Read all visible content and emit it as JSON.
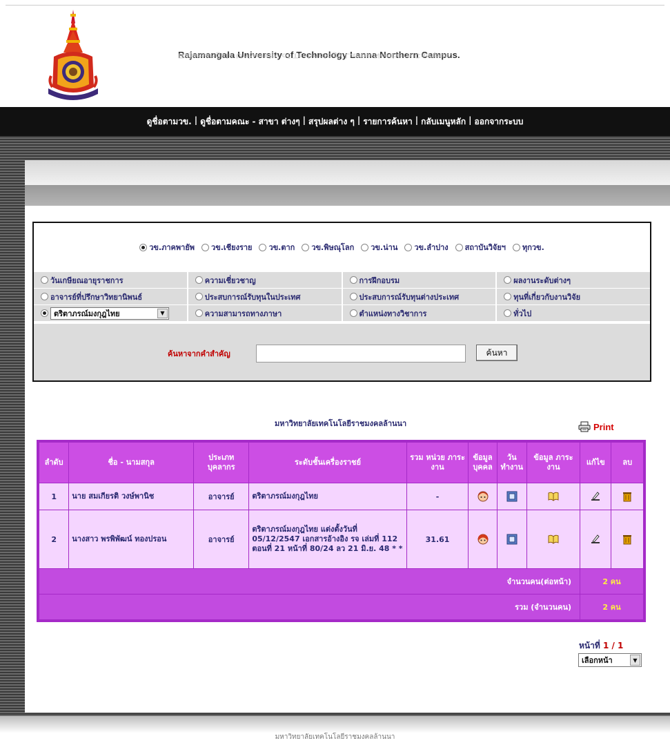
{
  "header": {
    "university_name": "Rajamangala University of Technology Lanna Northern Campus."
  },
  "nav": {
    "links": [
      "ดูชื่อตามวข.",
      "ดูชื่อตามคณะ - สาขา ต่างๆ",
      "สรุปผลต่าง ๆ",
      "รายการค้นหา",
      "กลับเมนูหลัก",
      "ออกจากระบบ"
    ],
    "separator": "|"
  },
  "search": {
    "campuses": [
      {
        "label": "วข.ภาคพายัพ",
        "selected": true
      },
      {
        "label": "วข.เชียงราย",
        "selected": false
      },
      {
        "label": "วข.ตาก",
        "selected": false
      },
      {
        "label": "วข.พิษณุโลก",
        "selected": false
      },
      {
        "label": "วข.น่าน",
        "selected": false
      },
      {
        "label": "วข.ลำปาง",
        "selected": false
      },
      {
        "label": "สถาบันวิจัยฯ",
        "selected": false
      },
      {
        "label": "ทุกวข.",
        "selected": false
      }
    ],
    "categories": {
      "row1": [
        "วันเกษียณอายุราชการ",
        "ความเชี่ยวชาญ",
        "การฝึกอบรม",
        "ผลงานระดับต่างๆ"
      ],
      "row2": [
        "อาจารย์ที่ปรึกษาวิทยานิพนธ์",
        "ประสบการณ์รับทุนในประเทศ",
        "ประสบการณ์รับทุนต่างประเทศ",
        "ทุนที่เกี่ยวกับงานวิจัย"
      ],
      "row3_select": "ตริตาภรณ์มงกุฎไทย",
      "row3": [
        "ความสามารถทางภาษา",
        "ตำแหน่งทางวิชาการ",
        "ทั่วไป"
      ]
    },
    "keyword_label": "ค้นหาจากคำสำคัญ",
    "keyword_value": "",
    "button_label": "ค้นหา"
  },
  "results": {
    "title": "มหาวิทยาลัยเทคโนโลยีราชมงคลล้านนา",
    "print_label": "Print",
    "columns": {
      "no": "ลำดับ",
      "name": "ชื่อ - นามสกุล",
      "type": "ประเภท บุคลากร",
      "decoration": "ระดับชั้นเครื่องราชย์",
      "workload": "รวม หน่วย ภาระงาน",
      "person": "ข้อมูล บุคคล",
      "days": "วัน ทำงาน",
      "load": "ข้อมูล ภาระงาน",
      "edit": "แก้ไข",
      "delete": "ลบ"
    },
    "rows": [
      {
        "no": "1",
        "name": "นาย สมเกียรติ วงษ์พานิช",
        "type": "อาจารย์",
        "decoration": "ตริตาภรณ์มงกุฎไทย",
        "workload": "-"
      },
      {
        "no": "2",
        "name": "นางสาว พรพิพัฒน์ ทองปรอน",
        "type": "อาจารย์",
        "decoration": "ตริตาภรณ์มงกุฎไทย แต่งตั้งวันที่ 05/12/2547 เอกสารอ้างอิง รจ เล่มที่ 112 ตอนที่ 21 หน้าที่ 80/24 ลว 21 มิ.ย. 48 * *",
        "workload": "31.61"
      }
    ],
    "summary": [
      {
        "label": "จำนวนคน(ต่อหน้า)",
        "value": "2 คน"
      },
      {
        "label": "รวม (จำนวนคน)",
        "value": "2 คน"
      }
    ]
  },
  "pager": {
    "label": "หน้าที่",
    "current": "1 / 1",
    "select_label": "เลือกหน้า"
  },
  "footer": {
    "text": "มหาวิทยาลัยเทคโนโลยีราชมงคลล้านนา"
  },
  "colors": {
    "table_border": "#a52ac8",
    "table_header": "#cc4ee4",
    "table_row": "#f5d5ff",
    "summary_value": "#ffee44",
    "keyword_label": "#c00000"
  }
}
